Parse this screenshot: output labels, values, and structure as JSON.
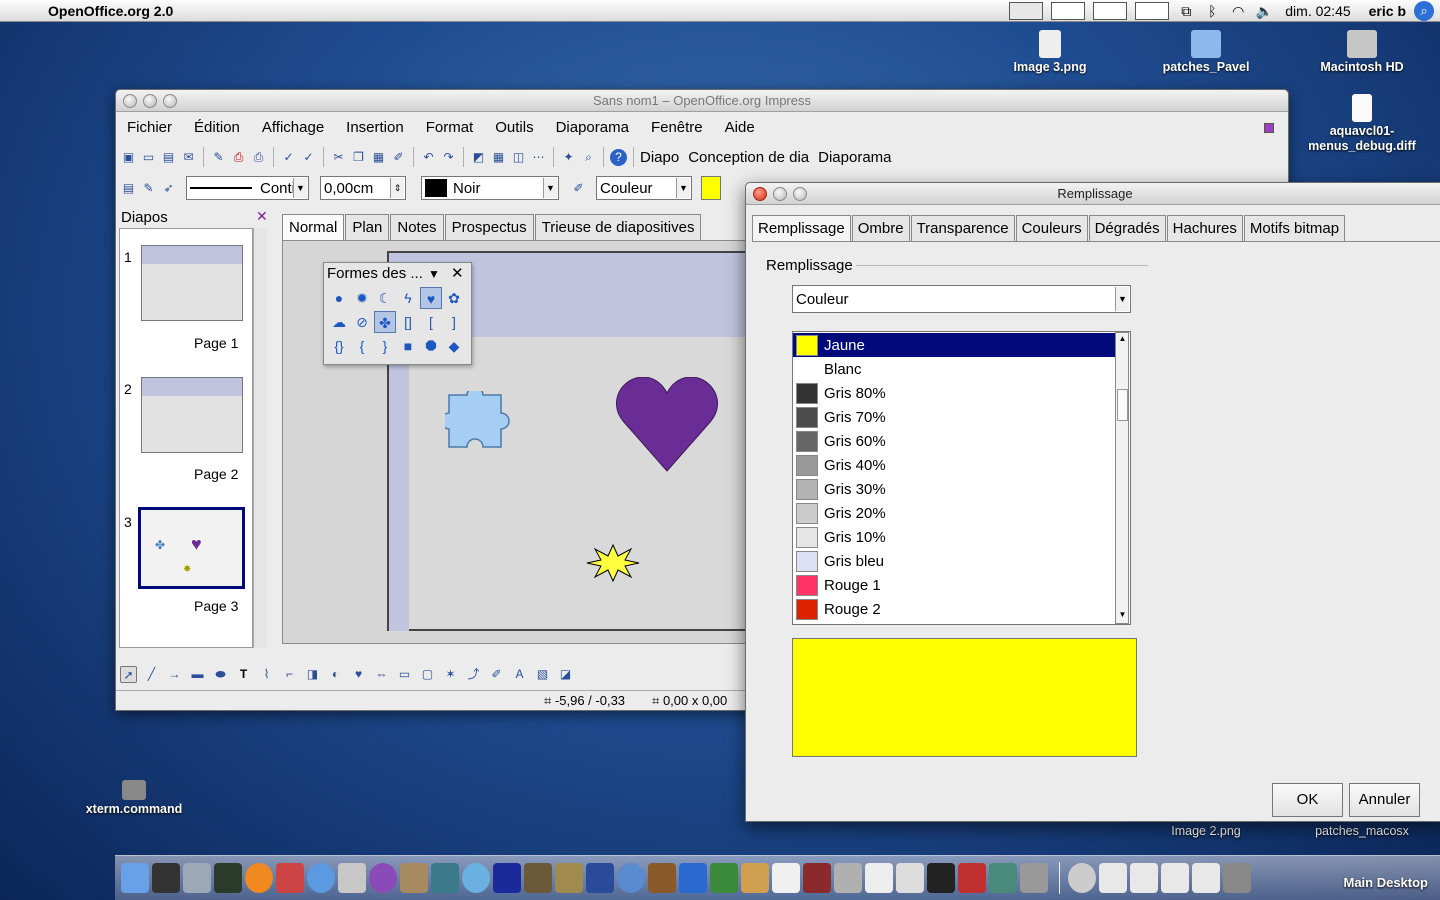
{
  "menubar": {
    "app_name": "OpenOffice.org 2.0",
    "clock": "dim. 02:45",
    "user": "eric b"
  },
  "desktop": {
    "icons": [
      {
        "label": "Image 3.png"
      },
      {
        "label": "patches_Pavel"
      },
      {
        "label": "Macintosh HD"
      },
      {
        "label": "aquavcl01-menus_debug.diff"
      },
      {
        "label": "xterm.command"
      },
      {
        "label": "Image 2.png"
      },
      {
        "label": "patches_macosx"
      }
    ]
  },
  "impress": {
    "title": "Sans nom1 – OpenOffice.org Impress",
    "menus": [
      "Fichier",
      "Édition",
      "Affichage",
      "Insertion",
      "Format",
      "Outils",
      "Diaporama",
      "Fenêtre",
      "Aide"
    ],
    "toolbar": {
      "diapo_label": "Diapo",
      "conception_label": "Conception de dia",
      "diaporama_label": "Diaporama"
    },
    "linebar": {
      "line_style": "Conti",
      "line_width": "0,00cm",
      "line_color": "Noir",
      "fill_type": "Couleur"
    },
    "slides_pane": {
      "title": "Diapos",
      "slides": [
        {
          "number": "1",
          "label": "Page 1"
        },
        {
          "number": "2",
          "label": "Page 2"
        },
        {
          "number": "3",
          "label": "Page 3"
        }
      ]
    },
    "view_tabs": [
      "Normal",
      "Plan",
      "Notes",
      "Prospectus",
      "Trieuse de diapositives"
    ],
    "formes_toolbar": {
      "title": "Formes des ..."
    },
    "status": {
      "position": "-5,96 / -0,33",
      "size": "0,00 x 0,00"
    }
  },
  "dialog": {
    "title": "Remplissage",
    "tabs": [
      "Remplissage",
      "Ombre",
      "Transparence",
      "Couleurs",
      "Dégradés",
      "Hachures",
      "Motifs bitmap"
    ],
    "group_label": "Remplissage",
    "fill_type_value": "Couleur",
    "colors": [
      {
        "name": "Jaune",
        "hex": "#ffff00",
        "selected": true
      },
      {
        "name": "Blanc",
        "hex": "#ffffff"
      },
      {
        "name": "Gris 80%",
        "hex": "#333333"
      },
      {
        "name": "Gris 70%",
        "hex": "#4c4c4c"
      },
      {
        "name": "Gris 60%",
        "hex": "#666666"
      },
      {
        "name": "Gris 40%",
        "hex": "#999999"
      },
      {
        "name": "Gris 30%",
        "hex": "#b3b3b3"
      },
      {
        "name": "Gris 20%",
        "hex": "#cccccc"
      },
      {
        "name": "Gris 10%",
        "hex": "#e6e6e6"
      },
      {
        "name": "Gris bleu",
        "hex": "#dddff5"
      },
      {
        "name": "Rouge 1",
        "hex": "#ff3366"
      },
      {
        "name": "Rouge 2",
        "hex": "#dc2300"
      }
    ],
    "preview_color": "#ffff00",
    "ok_label": "OK",
    "cancel_label": "Annuler"
  },
  "dock": {
    "desktop_label": "Main Desktop"
  }
}
